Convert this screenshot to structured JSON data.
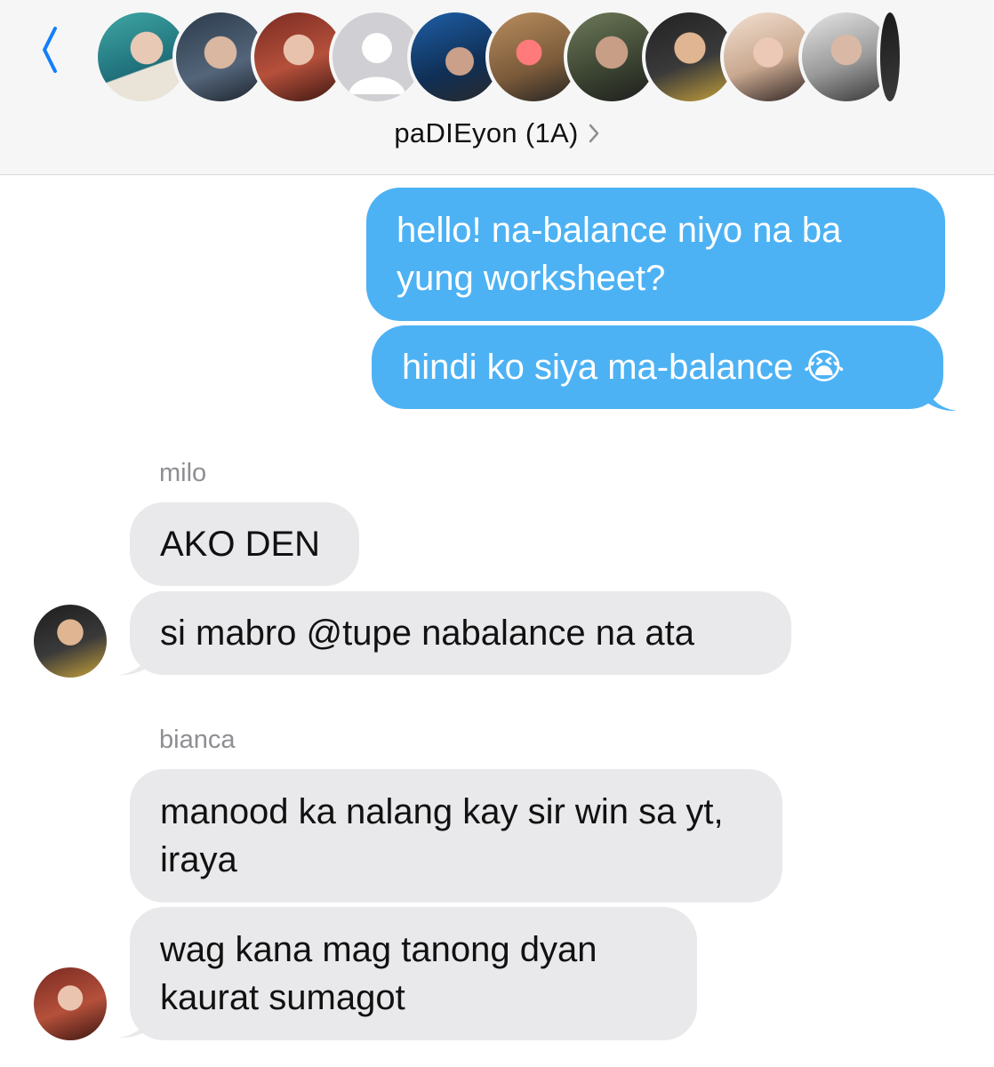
{
  "header": {
    "title": "paDIEyon (1A)",
    "back_icon": "chevron-left-icon",
    "info_icon": "chevron-right-icon",
    "member_count": 11
  },
  "messages": [
    {
      "direction": "outgoing",
      "text": "hello! na-balance niyo na ba yung worksheet?"
    },
    {
      "direction": "outgoing",
      "text": "hindi ko siya ma-balance 😭"
    },
    {
      "direction": "incoming",
      "sender": "milo",
      "text": "AKO DEN"
    },
    {
      "direction": "incoming",
      "sender": "milo",
      "text": "si mabro @tupe nabalance na ata"
    },
    {
      "direction": "incoming",
      "sender": "bianca",
      "text": "manood ka nalang kay sir win sa yt, iraya"
    },
    {
      "direction": "incoming",
      "sender": "bianca",
      "text": "wag kana mag tanong dyan kaurat sumagot"
    }
  ],
  "colors": {
    "outgoing_bubble": "#4db2f4",
    "incoming_bubble": "#e9e9eb",
    "accent": "#147efb"
  }
}
